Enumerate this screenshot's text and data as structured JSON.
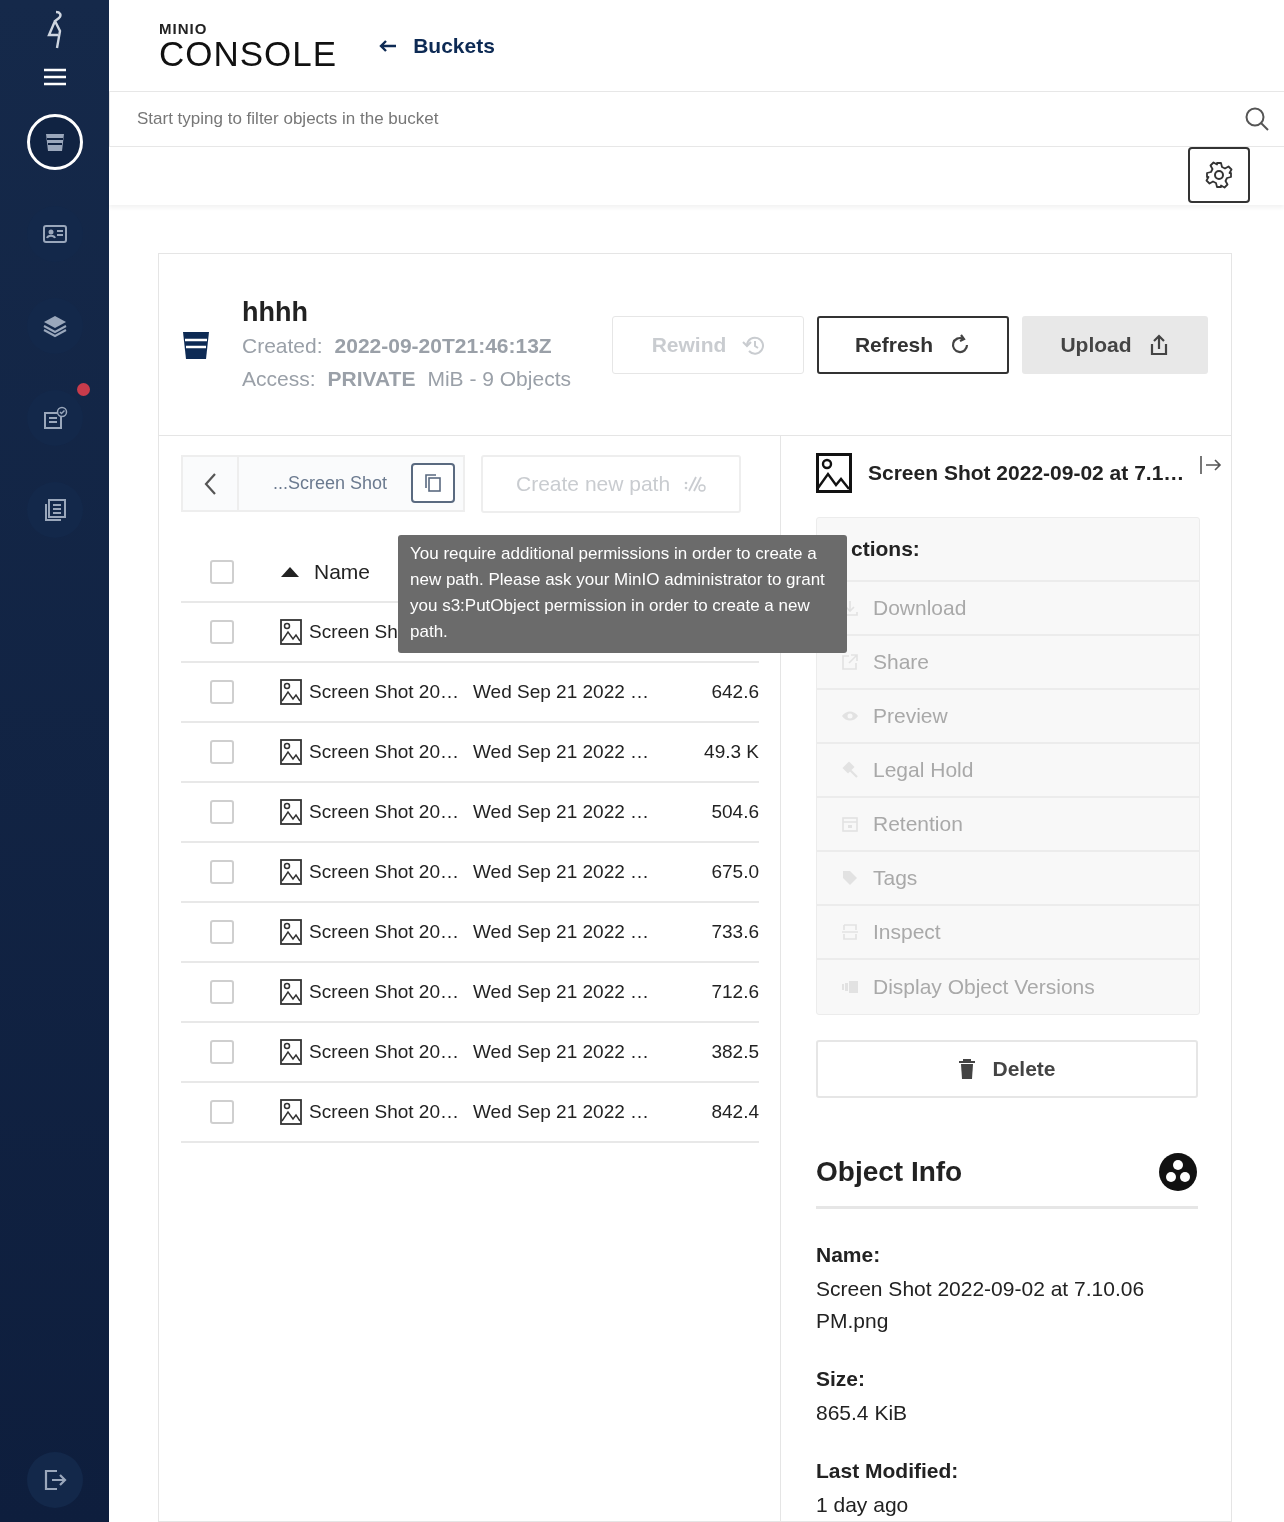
{
  "sidebar": {
    "items": [
      {
        "kind": "buckets",
        "selected": true,
        "badge": false
      },
      {
        "kind": "identity",
        "selected": false,
        "badge": false
      },
      {
        "kind": "layers",
        "selected": false,
        "badge": false
      },
      {
        "kind": "tasks",
        "selected": false,
        "badge": true
      },
      {
        "kind": "documents",
        "selected": false,
        "badge": false
      }
    ]
  },
  "header": {
    "logo_top": "MINIO",
    "logo_bottom": "CONSOLE",
    "back_link": "Buckets"
  },
  "search": {
    "placeholder": "Start typing to filter objects in the bucket"
  },
  "bucket": {
    "name": "hhhh",
    "created_label": "Created:",
    "created_value": "2022-09-20T21:46:13Z",
    "access_label": "Access:",
    "access_value": "PRIVATE",
    "summary": "MiB - 9 Objects",
    "buttons": [
      {
        "label": "Rewind",
        "kind": "rewind",
        "disabled": true
      },
      {
        "label": "Refresh",
        "kind": "refresh",
        "disabled": false
      },
      {
        "label": "Upload",
        "kind": "upload",
        "disabled": false
      }
    ]
  },
  "path_bar": {
    "breadcrumb": "...Screen Shot",
    "create_path": {
      "label": "Create new path",
      "disabled": true
    }
  },
  "tooltip": "You require additional permissions in order to create a new path. Please ask your MinIO administrator to grant you s3:PutObject permission in order to create a new path.",
  "table": {
    "all_selected": false,
    "columns": [
      {
        "label": "Name",
        "sorted": true
      }
    ],
    "rows": [
      {
        "name": "Screen Sh",
        "checked": false
      },
      {
        "name": "Screen Shot 20…",
        "modified": "Wed Sep 21 2022 …",
        "size": "642.6",
        "checked": false
      },
      {
        "name": "Screen Shot 20…",
        "modified": "Wed Sep 21 2022 …",
        "size": "49.3 K",
        "checked": false
      },
      {
        "name": "Screen Shot 20…",
        "modified": "Wed Sep 21 2022 …",
        "size": "504.6",
        "checked": false
      },
      {
        "name": "Screen Shot 20…",
        "modified": "Wed Sep 21 2022 …",
        "size": "675.0",
        "checked": false
      },
      {
        "name": "Screen Shot 20…",
        "modified": "Wed Sep 21 2022 …",
        "size": "733.6",
        "checked": false
      },
      {
        "name": "Screen Shot 20…",
        "modified": "Wed Sep 21 2022 …",
        "size": "712.6",
        "checked": false
      },
      {
        "name": "Screen Shot 20…",
        "modified": "Wed Sep 21 2022 …",
        "size": "382.5",
        "checked": false
      },
      {
        "name": "Screen Shot 20…",
        "modified": "Wed Sep 21 2022 …",
        "size": "842.4",
        "checked": false
      }
    ]
  },
  "details": {
    "title": "Screen Shot 2022-09-02 at 7.1…",
    "actions_title": "ctions:",
    "actions": [
      {
        "label": "Download",
        "kind": "download",
        "disabled": true
      },
      {
        "label": "Share",
        "kind": "share",
        "disabled": true
      },
      {
        "label": "Preview",
        "kind": "preview",
        "disabled": true
      },
      {
        "label": "Legal Hold",
        "kind": "legal",
        "disabled": true
      },
      {
        "label": "Retention",
        "kind": "retention",
        "disabled": true
      },
      {
        "label": "Tags",
        "kind": "tags",
        "disabled": true
      },
      {
        "label": "Inspect",
        "kind": "inspect",
        "disabled": true
      },
      {
        "label": "Display Object Versions",
        "kind": "versions",
        "disabled": true
      }
    ],
    "delete": "Delete",
    "info_title": "Object Info",
    "info": [
      {
        "label": "Name:",
        "value": "Screen Shot 2022-09-02 at 7.10.06 PM.png"
      },
      {
        "label": "Size:",
        "value": "865.4 KiB"
      },
      {
        "label": "Last Modified:",
        "value": "1 day ago"
      }
    ]
  }
}
